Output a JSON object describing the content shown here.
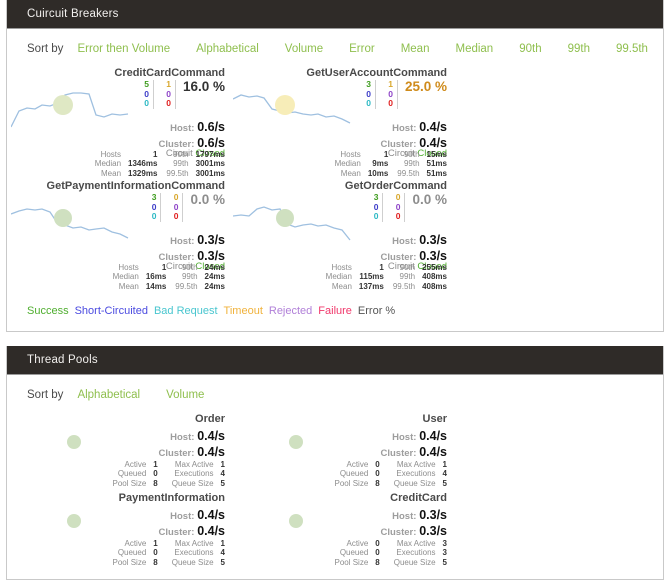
{
  "circuit_panel": {
    "header": "Cuircuit Breakers",
    "sort": {
      "label": "Sort by",
      "options": [
        "Error then Volume",
        "Alphabetical",
        "Volume",
        "Error",
        "Mean",
        "Median",
        "90th",
        "99th",
        "99.5th"
      ]
    },
    "cards": [
      {
        "name": "CreditCardCommand",
        "success": "5",
        "short_circuited": "0",
        "bad_request": "0",
        "timeout": "1",
        "rejected": "0",
        "failure": "0",
        "error_pct": "16.0 %",
        "error_color": "#333333",
        "blip_color": "#dfe8c4",
        "blip_size": 20,
        "host_label": "Host:",
        "host_rate": "0.6/s",
        "cluster_label": "Cluster:",
        "cluster_rate": "0.6/s",
        "circuit_label": "Circuit",
        "circuit_state": "Closed",
        "hosts_label": "Hosts",
        "hosts": "1",
        "median_label": "Median",
        "median": "1346ms",
        "mean_label": "Mean",
        "mean": "1329ms",
        "p90_label": "90th",
        "p90": "1797ms",
        "p99_label": "99th",
        "p99": "3001ms",
        "p995_label": "99.5th",
        "p995": "3001ms",
        "spark": "0,46 8,30 16,27 24,28 31,24 39,25 47,22 54,14 62,12 70,12 78,13 85,34 93,36 101,33 109,34 117,33"
      },
      {
        "name": "GetUserAccountCommand",
        "success": "3",
        "short_circuited": "0",
        "bad_request": "0",
        "timeout": "1",
        "rejected": "0",
        "failure": "0",
        "error_pct": "25.0 %",
        "error_color": "#cf8b1b",
        "blip_color": "#f7edb8",
        "blip_size": 20,
        "host_label": "Host:",
        "host_rate": "0.4/s",
        "cluster_label": "Cluster:",
        "cluster_rate": "0.4/s",
        "circuit_label": "Circuit",
        "circuit_state": "Closed",
        "hosts_label": "Hosts",
        "hosts": "1",
        "median_label": "Median",
        "median": "9ms",
        "mean_label": "Mean",
        "mean": "10ms",
        "p90_label": "90th",
        "p90": "15ms",
        "p99_label": "99th",
        "p99": "51ms",
        "p995_label": "99.5th",
        "p995": "51ms",
        "spark": "0,18 8,14 16,16 24,15 31,17 39,28 47,30 54,32 62,31 70,33 78,34 85,33 93,36 101,35 109,38 117,42"
      },
      {
        "name": "GetPaymentInformationCommand",
        "success": "3",
        "short_circuited": "0",
        "bad_request": "0",
        "timeout": "0",
        "rejected": "0",
        "failure": "0",
        "error_pct": "0.0 %",
        "error_color": "#8d8d8d",
        "blip_color": "#cfe0c0",
        "blip_size": 18,
        "host_label": "Host:",
        "host_rate": "0.3/s",
        "cluster_label": "Cluster:",
        "cluster_rate": "0.3/s",
        "circuit_label": "Circuit",
        "circuit_state": "Closed",
        "hosts_label": "Hosts",
        "hosts": "1",
        "median_label": "Median",
        "median": "16ms",
        "mean_label": "Mean",
        "mean": "14ms",
        "p90_label": "90th",
        "p90": "24ms",
        "p99_label": "99th",
        "p99": "24ms",
        "p995_label": "99.5th",
        "p995": "24ms",
        "spark": "0,20 8,17 16,15 24,16 31,15 39,18 47,30 54,31 62,34 70,33 78,36 85,35 93,34 101,38 109,40 117,44"
      },
      {
        "name": "GetOrderCommand",
        "success": "3",
        "short_circuited": "0",
        "bad_request": "0",
        "timeout": "0",
        "rejected": "0",
        "failure": "0",
        "error_pct": "0.0 %",
        "error_color": "#8d8d8d",
        "blip_color": "#cfe0c0",
        "blip_size": 18,
        "host_label": "Host:",
        "host_rate": "0.3/s",
        "cluster_label": "Cluster:",
        "cluster_rate": "0.3/s",
        "circuit_label": "Circuit",
        "circuit_state": "Closed",
        "hosts_label": "Hosts",
        "hosts": "1",
        "median_label": "Median",
        "median": "115ms",
        "mean_label": "Mean",
        "mean": "137ms",
        "p90_label": "90th",
        "p90": "255ms",
        "p99_label": "99th",
        "p99": "408ms",
        "p995_label": "99.5th",
        "p995": "408ms",
        "spark": "0,22 8,21 16,22 24,15 31,13 39,16 47,15 54,30 62,33 70,31 78,30 85,32 93,31 101,34 109,36 117,46"
      }
    ],
    "legend": [
      {
        "text": "Success",
        "color": "#4fae2f"
      },
      {
        "text": "Short-Circuited",
        "color": "#4a4ae0"
      },
      {
        "text": "Bad Request",
        "color": "#49c6cf"
      },
      {
        "text": "Timeout",
        "color": "#f0b23c"
      },
      {
        "text": "Rejected",
        "color": "#b07fd8"
      },
      {
        "text": "Failure",
        "color": "#f0386b"
      },
      {
        "text": "Error %",
        "color": "#555555"
      }
    ]
  },
  "threadpool_panel": {
    "header": "Thread Pools",
    "sort": {
      "label": "Sort by",
      "options": [
        "Alphabetical",
        "Volume"
      ]
    },
    "cards": [
      {
        "name": "Order",
        "blip_color": "#cfe0c0",
        "host_label": "Host:",
        "host_rate": "0.4/s",
        "cluster_label": "Cluster:",
        "cluster_rate": "0.4/s",
        "active_label": "Active",
        "active": "1",
        "queued_label": "Queued",
        "queued": "0",
        "pool_size_label": "Pool Size",
        "pool_size": "8",
        "max_active_label": "Max Active",
        "max_active": "1",
        "executions_label": "Executions",
        "executions": "4",
        "queue_size_label": "Queue Size",
        "queue_size": "5"
      },
      {
        "name": "User",
        "blip_color": "#cfe0c0",
        "host_label": "Host:",
        "host_rate": "0.4/s",
        "cluster_label": "Cluster:",
        "cluster_rate": "0.4/s",
        "active_label": "Active",
        "active": "0",
        "queued_label": "Queued",
        "queued": "0",
        "pool_size_label": "Pool Size",
        "pool_size": "8",
        "max_active_label": "Max Active",
        "max_active": "1",
        "executions_label": "Executions",
        "executions": "4",
        "queue_size_label": "Queue Size",
        "queue_size": "5"
      },
      {
        "name": "PaymentInformation",
        "blip_color": "#cfe0c0",
        "host_label": "Host:",
        "host_rate": "0.4/s",
        "cluster_label": "Cluster:",
        "cluster_rate": "0.4/s",
        "active_label": "Active",
        "active": "1",
        "queued_label": "Queued",
        "queued": "0",
        "pool_size_label": "Pool Size",
        "pool_size": "8",
        "max_active_label": "Max Active",
        "max_active": "1",
        "executions_label": "Executions",
        "executions": "4",
        "queue_size_label": "Queue Size",
        "queue_size": "5"
      },
      {
        "name": "CreditCard",
        "blip_color": "#cfe0c0",
        "host_label": "Host:",
        "host_rate": "0.3/s",
        "cluster_label": "Cluster:",
        "cluster_rate": "0.3/s",
        "active_label": "Active",
        "active": "0",
        "queued_label": "Queued",
        "queued": "0",
        "pool_size_label": "Pool Size",
        "pool_size": "8",
        "max_active_label": "Max Active",
        "max_active": "3",
        "executions_label": "Executions",
        "executions": "3",
        "queue_size_label": "Queue Size",
        "queue_size": "5"
      }
    ]
  }
}
